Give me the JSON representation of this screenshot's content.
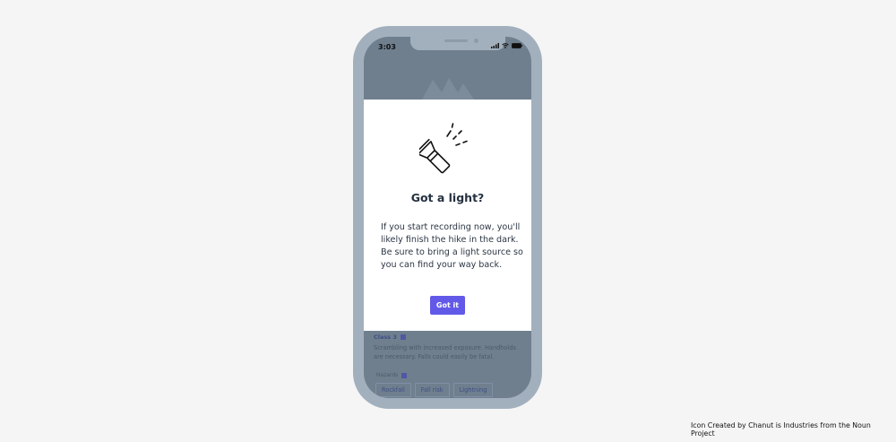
{
  "status_bar": {
    "time": "3:03"
  },
  "modal": {
    "icon": "flashlight-icon",
    "title": "Got a light?",
    "body": "If you start recording now, you'll likely finish the hike in the dark. Be sure to bring a light source so you can find your way back.",
    "button_label": "Got it"
  },
  "background_content": {
    "grade_label": "Class 3",
    "grade_description": "Scrambling with increased exposure. Handholds are necessary. Falls could easily be fatal.",
    "hazards_label": "Hazards",
    "hazard_tags": [
      "Rockfall",
      "Fall risk",
      "Lightning"
    ]
  },
  "credit": "Icon Created by Chanut is Industries from the Noun Project",
  "colors": {
    "page_bg": "#f5f5f5",
    "phone_frame": "#a2b0bd",
    "overlay": "#6f7f8e",
    "modal_bg": "#ffffff",
    "accent": "#6259e8",
    "title_text": "#253140"
  }
}
